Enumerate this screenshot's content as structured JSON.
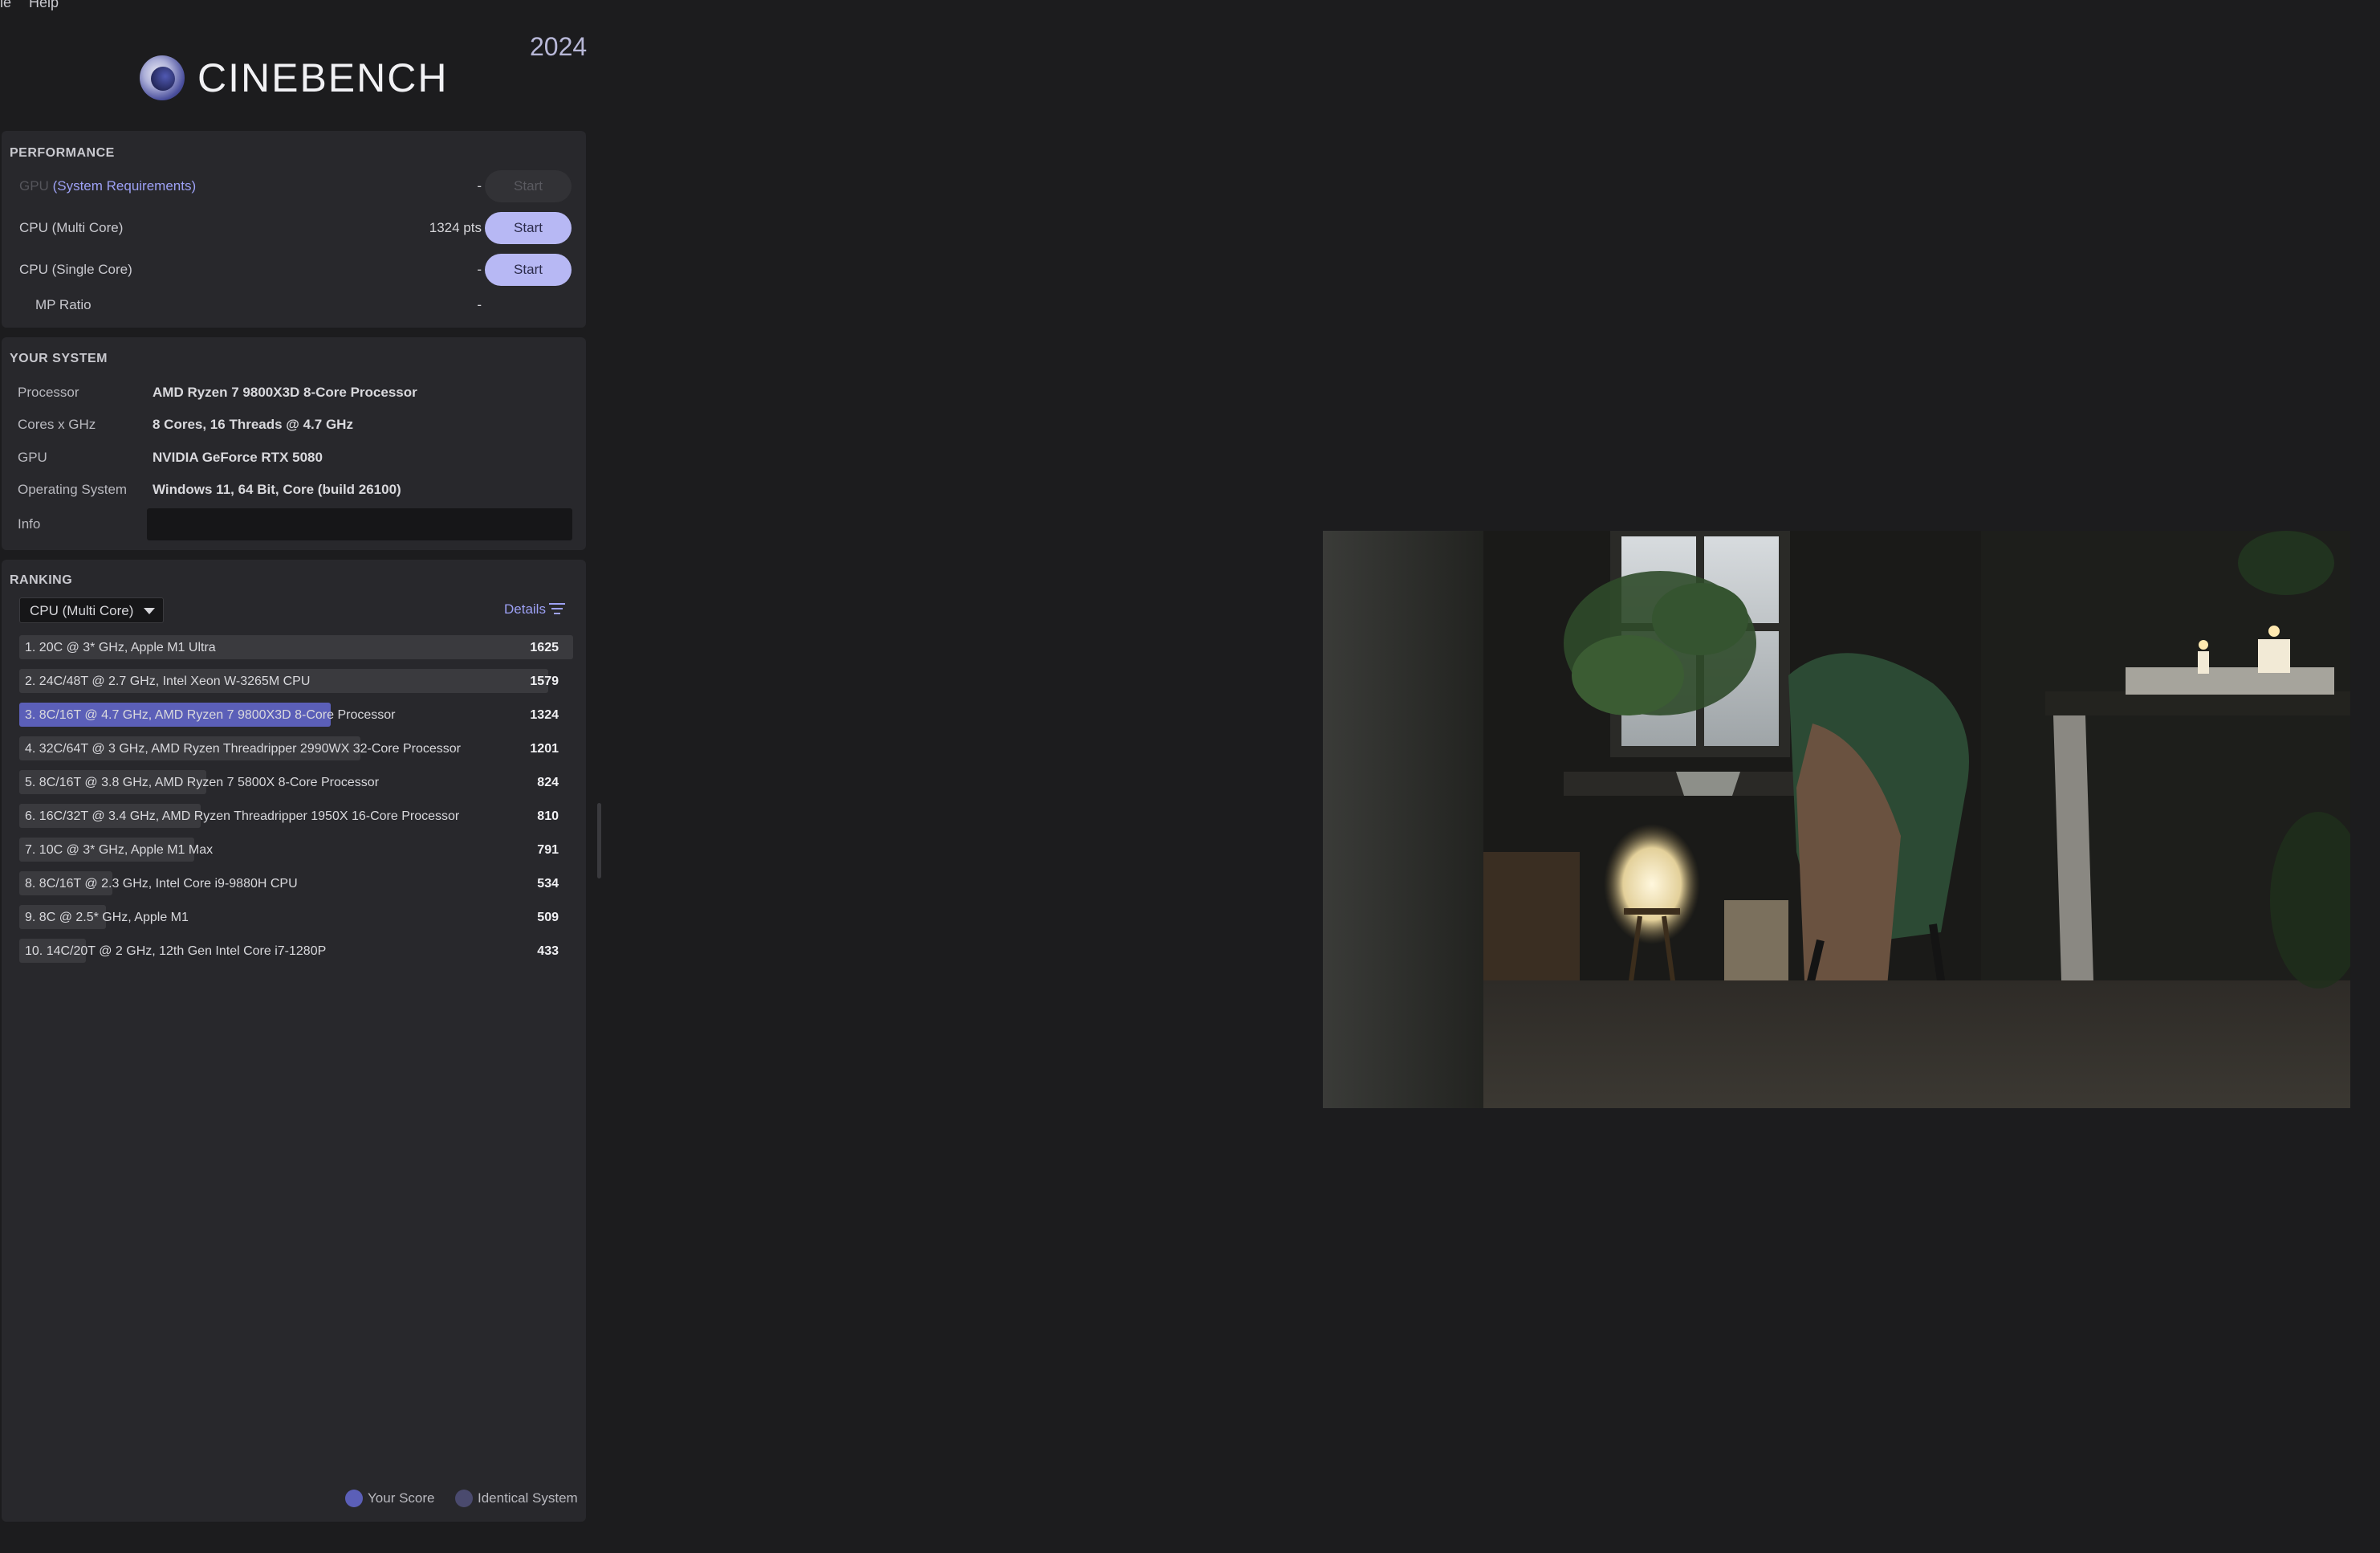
{
  "menu": [
    "le",
    "Help"
  ],
  "app": {
    "name": "CINEBENCH",
    "year": "2024"
  },
  "performance": {
    "title": "PERFORMANCE",
    "gpu": {
      "label": "GPU",
      "link": "(System Requirements)",
      "value": "-",
      "button": "Start",
      "enabled": false
    },
    "cpu_multi": {
      "label": "CPU (Multi Core)",
      "value": "1324 pts",
      "button": "Start"
    },
    "cpu_single": {
      "label": "CPU (Single Core)",
      "value": "-",
      "button": "Start"
    },
    "mp_ratio": {
      "label": "MP Ratio",
      "value": "-"
    }
  },
  "system": {
    "title": "YOUR SYSTEM",
    "rows": [
      {
        "key": "Processor",
        "value": "AMD Ryzen 7 9800X3D 8-Core Processor"
      },
      {
        "key": "Cores x GHz",
        "value": "8 Cores, 16 Threads @ 4.7 GHz"
      },
      {
        "key": "GPU",
        "value": "NVIDIA GeForce RTX 5080"
      },
      {
        "key": "Operating System",
        "value": "Windows 11, 64 Bit, Core (build 26100)"
      }
    ],
    "info_label": "Info"
  },
  "ranking": {
    "title": "RANKING",
    "selected": "CPU (Multi Core)",
    "details": "Details",
    "items": [
      {
        "label": "1. 20C @ 3* GHz, Apple M1 Ultra",
        "score": 1625
      },
      {
        "label": "2. 24C/48T @ 2.7 GHz, Intel Xeon W-3265M CPU",
        "score": 1579
      },
      {
        "label": "3. 8C/16T @ 4.7 GHz, AMD Ryzen 7 9800X3D 8-Core Processor",
        "score": 1324,
        "yours": true
      },
      {
        "label": "4. 32C/64T @ 3 GHz, AMD Ryzen Threadripper 2990WX 32-Core Processor",
        "score": 1201
      },
      {
        "label": "5. 8C/16T @ 3.8 GHz, AMD Ryzen 7 5800X 8-Core Processor",
        "score": 824
      },
      {
        "label": "6. 16C/32T @ 3.4 GHz, AMD Ryzen Threadripper 1950X 16-Core Processor",
        "score": 810
      },
      {
        "label": "7. 10C @ 3* GHz, Apple M1 Max",
        "score": 791
      },
      {
        "label": "8. 8C/16T @ 2.3 GHz, Intel Core i9-9880H CPU",
        "score": 534
      },
      {
        "label": "9. 8C @ 2.5* GHz, Apple M1",
        "score": 509
      },
      {
        "label": "10. 14C/20T @ 2 GHz, 12th Gen Intel Core i7-1280P",
        "score": 433
      }
    ],
    "legend": {
      "your_score": "Your Score",
      "identical": "Identical System"
    }
  },
  "colors": {
    "accent": "#b7b8f4",
    "your_bar": "#5b5fb8",
    "bar": "#3a3a3e",
    "identical_dot": "#4a4a6e"
  }
}
